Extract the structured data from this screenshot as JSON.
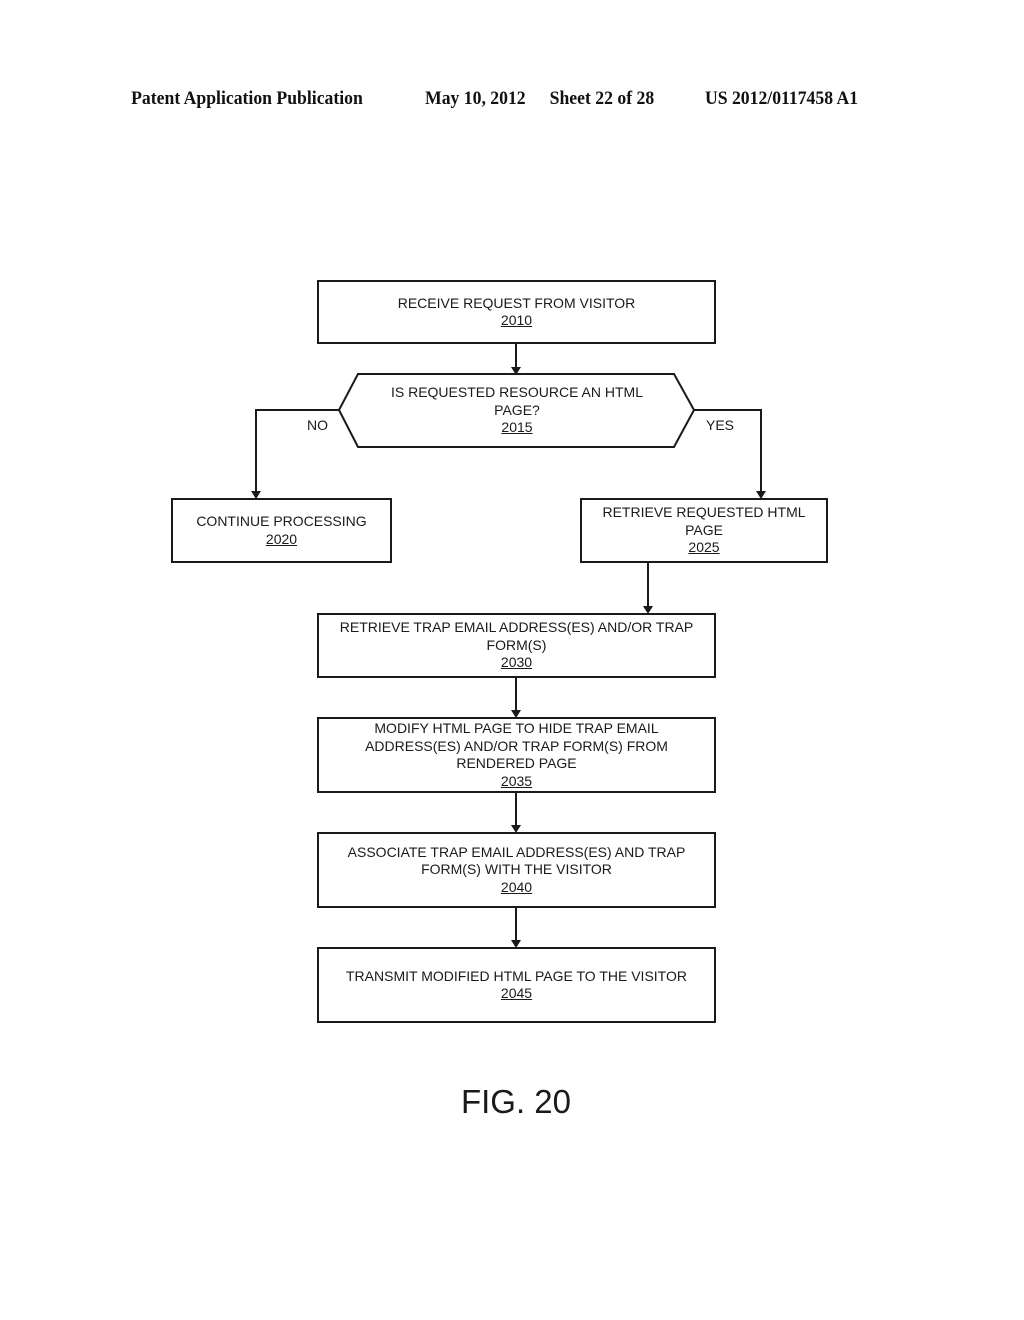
{
  "header": {
    "left": "Patent Application Publication",
    "date": "May 10, 2012",
    "sheet": "Sheet 22 of 28",
    "number": "US 2012/0117458 A1"
  },
  "nodes": {
    "n2010": {
      "text": "RECEIVE REQUEST FROM VISITOR",
      "ref": "2010"
    },
    "n2015": {
      "text": "IS REQUESTED RESOURCE AN HTML PAGE?",
      "ref": "2015"
    },
    "n2020": {
      "text": "CONTINUE PROCESSING",
      "ref": "2020"
    },
    "n2025": {
      "text": "RETRIEVE REQUESTED HTML PAGE",
      "ref": "2025"
    },
    "n2030": {
      "text": "RETRIEVE TRAP EMAIL ADDRESS(ES) AND/OR TRAP FORM(S)",
      "ref": "2030"
    },
    "n2035": {
      "text": "MODIFY HTML PAGE TO HIDE TRAP EMAIL ADDRESS(ES) AND/OR TRAP FORM(S) FROM RENDERED PAGE",
      "ref": "2035"
    },
    "n2040": {
      "text": "ASSOCIATE TRAP EMAIL ADDRESS(ES) AND TRAP FORM(S) WITH THE VISITOR",
      "ref": "2040"
    },
    "n2045": {
      "text": "TRANSMIT MODIFIED HTML PAGE TO THE VISITOR",
      "ref": "2045"
    }
  },
  "edges": {
    "no_label": "NO",
    "yes_label": "YES"
  },
  "figure_label": "FIG. 20"
}
